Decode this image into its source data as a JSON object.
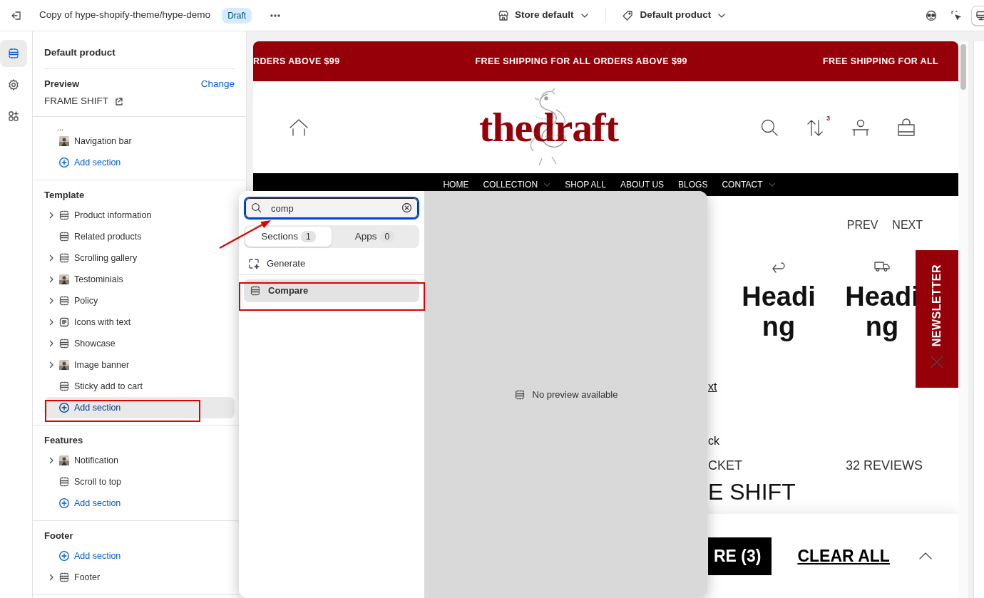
{
  "topbar": {
    "title": "Copy of hype-shopify-theme/hype-demo",
    "badge": "Draft",
    "store": "Store default",
    "template": "Default product",
    "view_buttons": [
      {
        "kind": "inspector",
        "selected": false
      },
      {
        "kind": "select",
        "selected": false
      },
      {
        "kind": "desktop",
        "selected": true
      }
    ]
  },
  "rail": [
    {
      "kind": "sections",
      "selected": true
    },
    {
      "kind": "settings",
      "selected": false
    },
    {
      "kind": "apps",
      "selected": false
    }
  ],
  "sidebar": {
    "title": "Default product",
    "preview": {
      "label": "Preview",
      "action": "Change",
      "value": "FRAME SHIFT"
    },
    "groups": [
      {
        "items": [
          {
            "label": "...",
            "kind": "overflow"
          },
          {
            "label": "Navigation bar",
            "kind": "picture",
            "expandable": false,
            "hovered": false,
            "highlighted": false
          },
          {
            "label": "Add section",
            "kind": "add",
            "expandable": false,
            "hovered": false,
            "highlighted": false
          }
        ]
      },
      {
        "heading": "Template",
        "items": [
          {
            "label": "Product information",
            "kind": "section",
            "expandable": true,
            "hovered": false,
            "highlighted": false
          },
          {
            "label": "Related products",
            "kind": "section",
            "expandable": false,
            "hovered": false,
            "highlighted": false
          },
          {
            "label": "Scrolling gallery",
            "kind": "section",
            "expandable": true,
            "hovered": false,
            "highlighted": false
          },
          {
            "label": "Testominials",
            "kind": "picture",
            "expandable": true,
            "hovered": false,
            "highlighted": false
          },
          {
            "label": "Policy",
            "kind": "section",
            "expandable": true,
            "hovered": false,
            "highlighted": false
          },
          {
            "label": "Icons with text",
            "kind": "text",
            "expandable": true,
            "hovered": false,
            "highlighted": false
          },
          {
            "label": "Showcase",
            "kind": "section",
            "expandable": true,
            "hovered": false,
            "highlighted": false
          },
          {
            "label": "Image banner",
            "kind": "picture",
            "expandable": true,
            "hovered": false,
            "highlighted": false
          },
          {
            "label": "Sticky add to cart",
            "kind": "section",
            "expandable": false,
            "hovered": false,
            "highlighted": false
          },
          {
            "label": "Add section",
            "kind": "add",
            "expandable": false,
            "hovered": true,
            "highlighted": true
          }
        ]
      },
      {
        "heading": "Features",
        "items": [
          {
            "label": "Notification",
            "kind": "picture",
            "expandable": true,
            "hovered": false,
            "highlighted": false
          },
          {
            "label": "Scroll to top",
            "kind": "section",
            "expandable": false,
            "hovered": false,
            "highlighted": false
          },
          {
            "label": "Add section",
            "kind": "add",
            "expandable": false,
            "hovered": false,
            "highlighted": false
          }
        ]
      },
      {
        "heading": "Footer",
        "items": [
          {
            "label": "Add section",
            "kind": "add",
            "expandable": false,
            "hovered": false,
            "highlighted": false
          },
          {
            "label": "Footer",
            "kind": "section",
            "expandable": true,
            "hovered": false,
            "highlighted": false
          }
        ]
      }
    ]
  },
  "popover": {
    "search": {
      "value": "comp",
      "annotated": true
    },
    "tabs": [
      {
        "label": "Sections",
        "count": "1",
        "selected": true
      },
      {
        "label": "Apps",
        "count": "0",
        "selected": false
      }
    ],
    "generate": "Generate",
    "results": [
      {
        "label": "Compare",
        "selected": true,
        "highlighted": true
      }
    ],
    "preview_message": "No preview available"
  },
  "storefront": {
    "announcements": [
      "RDERS ABOVE $99",
      "FREE SHIPPING FOR ALL ORDERS ABOVE $99",
      "FREE SHIPPING FOR ALL"
    ],
    "logo": "thedraft",
    "compare_count": "3",
    "nav": [
      {
        "label": "HOME",
        "dropdown": false
      },
      {
        "label": "COLLECTION",
        "dropdown": true
      },
      {
        "label": "SHOP ALL",
        "dropdown": false
      },
      {
        "label": "ABOUT US",
        "dropdown": false
      },
      {
        "label": "BLOGS",
        "dropdown": false
      },
      {
        "label": "CONTACT",
        "dropdown": true
      }
    ],
    "pager": [
      "PREV",
      "NEXT"
    ],
    "features": [
      {
        "kind": "return",
        "heading": "Heading"
      },
      {
        "kind": "truck",
        "heading": "Heading"
      }
    ],
    "link_fragment": "xt",
    "text_fragment": "ck",
    "vendor_fragment": "CKET",
    "reviews": "32 REVIEWS",
    "title_fragment": "E SHIFT",
    "newsletter": "NEWSLETTER",
    "compare_bar": {
      "button": "RE (3)",
      "clear": "CLEAR ALL"
    }
  }
}
